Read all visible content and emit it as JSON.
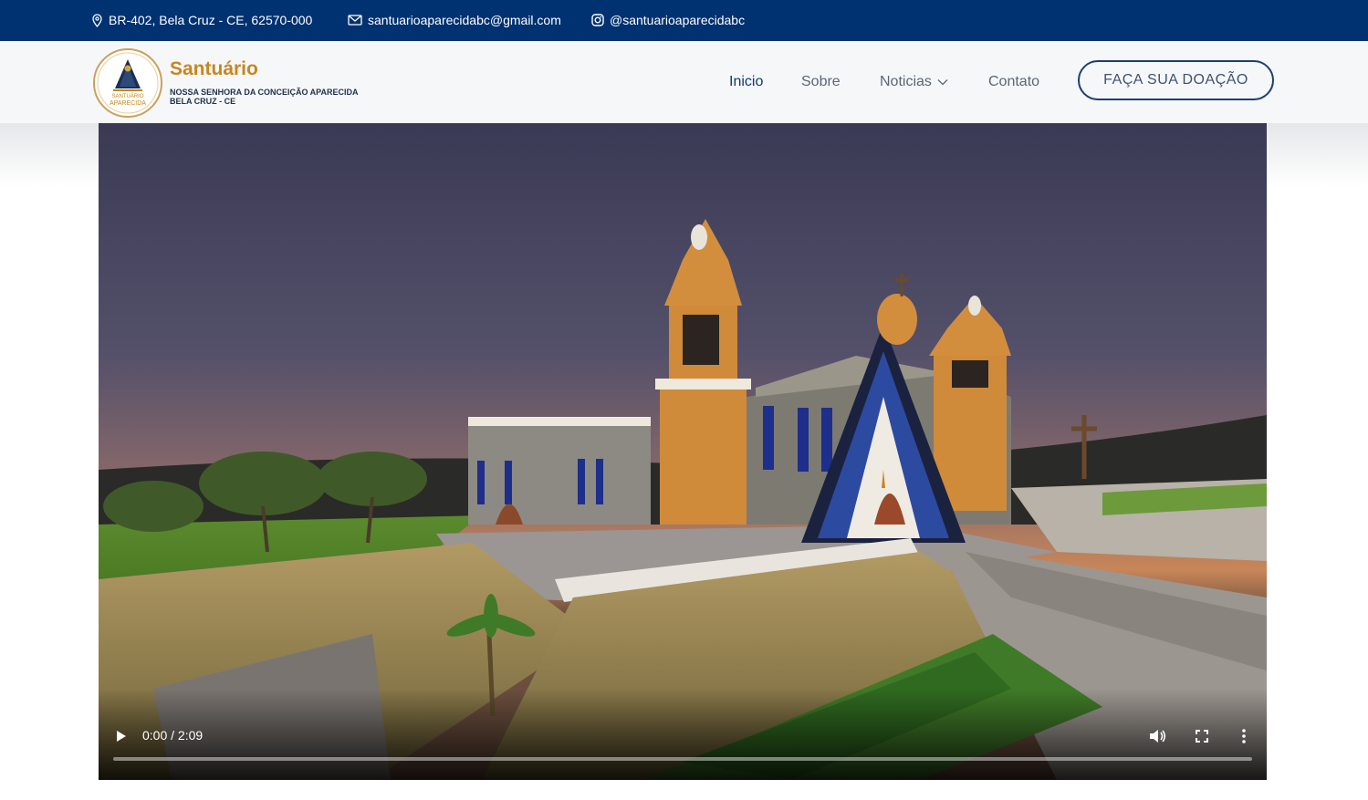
{
  "topbar": {
    "address": "BR-402, Bela Cruz - CE, 62570-000",
    "email": "santuarioaparecidabc@gmail.com",
    "instagram": "@santuarioaparecidabc"
  },
  "brand": {
    "title": "Santuário",
    "subtitle_line1": "NOSSA SENHORA DA CONCEIÇÃO APARECIDA",
    "subtitle_line2": "BELA CRUZ - CE",
    "logo_text_top": "SANTUÁRIO",
    "logo_text_bottom": "APARECIDA"
  },
  "nav": {
    "items": [
      {
        "label": "Inicio",
        "active": true
      },
      {
        "label": "Sobre",
        "active": false
      },
      {
        "label": "Noticias",
        "active": false,
        "has_dropdown": true
      },
      {
        "label": "Contato",
        "active": false
      }
    ],
    "donate_label": "FAÇA SUA DOAÇÃO"
  },
  "video": {
    "time_display": "0:00 / 2:09",
    "progress": 0
  },
  "colors": {
    "topbar": "#003170",
    "brand_gold": "#c8861d",
    "nav_active": "#0e3a73",
    "button_border": "#1d3f6e"
  }
}
